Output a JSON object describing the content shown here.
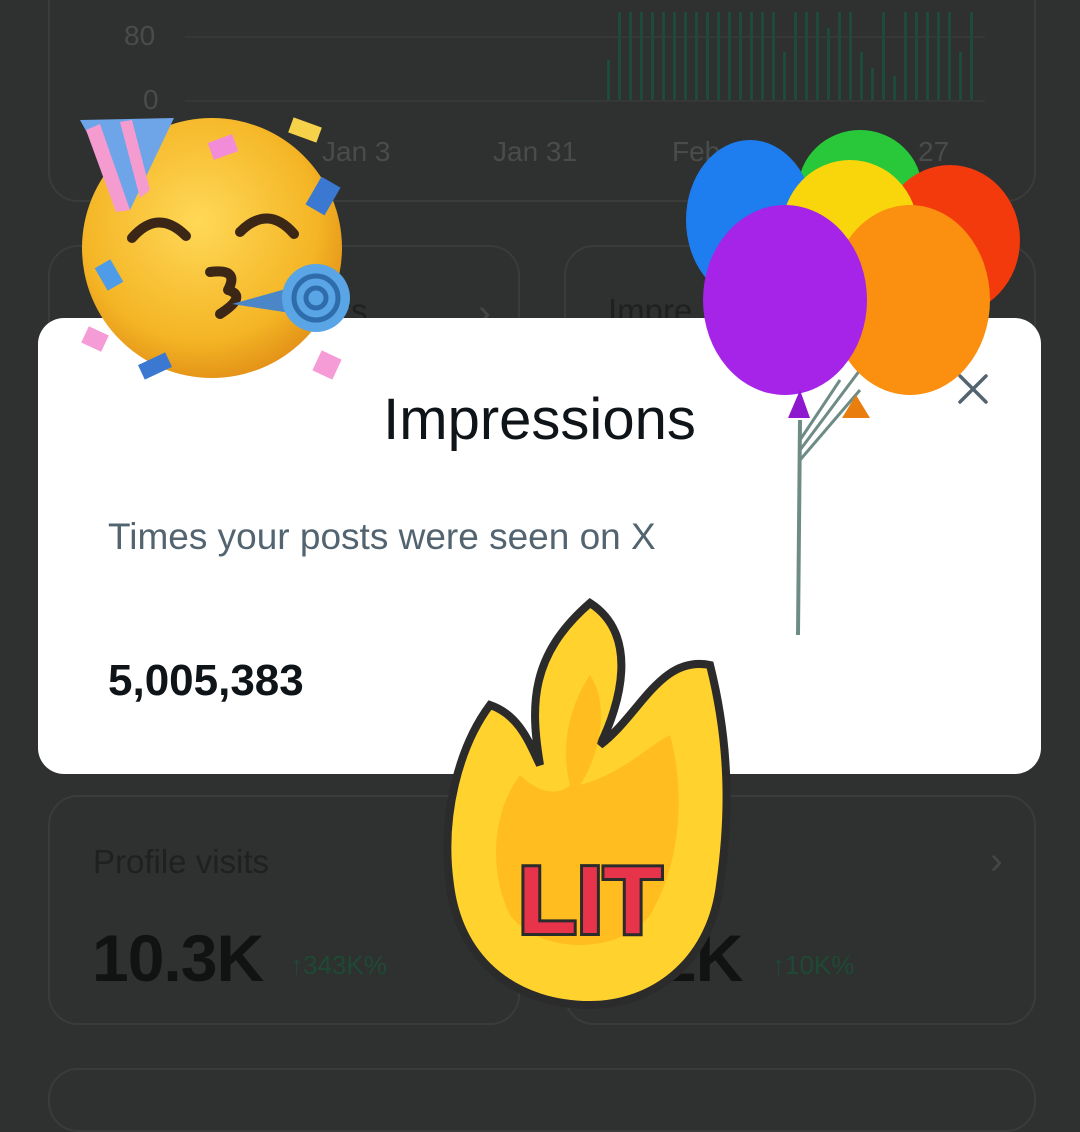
{
  "chart": {
    "y_tick_labels": [
      "80",
      "0"
    ],
    "x_tick_labels": [
      "Jan 3",
      "Jan 31",
      "Feb 1",
      "27"
    ],
    "bar_color": "#1d4a3a"
  },
  "chart_data": {
    "type": "bar",
    "title": "",
    "xlabel": "",
    "ylabel": "",
    "x_tick_labels": [
      "Jan 3",
      "Jan 31",
      "Feb 1",
      "27"
    ],
    "y_tick_labels": [
      "80",
      "0"
    ],
    "ylim": [
      0,
      80
    ],
    "grid": true,
    "values": [
      0,
      0,
      0,
      0,
      50,
      110,
      110,
      110,
      110,
      110,
      110,
      110,
      110,
      110,
      110,
      110,
      110,
      110,
      110,
      110,
      60,
      110,
      110,
      110,
      90,
      110,
      110,
      60,
      40,
      110,
      30,
      110,
      110,
      110,
      110,
      110,
      60,
      110
    ]
  },
  "cards": {
    "followers": {
      "title_fragment": "rs"
    },
    "impressions": {
      "title_fragment": "Impre"
    },
    "profile_visits": {
      "title": "Profile visits",
      "value": "10.3K",
      "delta": "343K%"
    },
    "second": {
      "value_fragment": "2K",
      "delta": "10K%"
    }
  },
  "modal": {
    "title": "Impressions",
    "description": "Times your posts were seen on X",
    "value": "5,005,383",
    "close_icon": "close-icon"
  },
  "stickers": {
    "party_face": "partying-face-emoji",
    "balloons": "balloons-sticker",
    "lit": {
      "text": "LIT"
    }
  },
  "colors": {
    "background": "#2f3030",
    "modal_bg": "#ffffff",
    "delta_green": "#1e4a35",
    "text_primary": "#0f1419",
    "text_secondary": "#536471"
  }
}
